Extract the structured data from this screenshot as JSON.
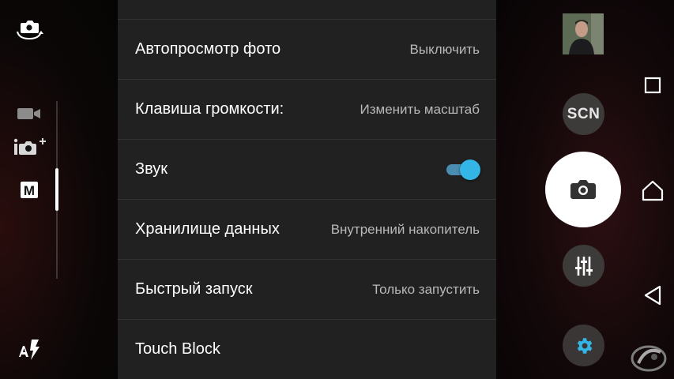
{
  "settings": {
    "rows": [
      {
        "label": "Автопросмотр фото",
        "value": "Выключить"
      },
      {
        "label": "Клавиша громкости:",
        "value": "Изменить масштаб"
      },
      {
        "label": "Звук",
        "toggle": true
      },
      {
        "label": "Хранилище данных",
        "value": "Внутренний накопитель"
      },
      {
        "label": "Быстрый запуск",
        "value": "Только запустить"
      },
      {
        "label": "Touch Block"
      }
    ]
  },
  "mode_selector": {
    "modes": [
      "video-camera-icon",
      "superior-auto-icon",
      "manual-mode-icon"
    ],
    "selected": "manual-mode-icon",
    "manual_label": "M"
  },
  "controls": {
    "scene_label": "SCN",
    "icons": [
      "switch-camera-icon",
      "flash-auto-icon",
      "shutter-camera-icon",
      "manual-adjust-icon",
      "settings-gear-icon"
    ]
  },
  "navigation": {
    "icons": [
      "recent-apps-icon",
      "home-icon",
      "back-icon"
    ]
  },
  "colors": {
    "panel": "#212121",
    "accent": "#33b5e5",
    "label": "#ffffff",
    "value": "#b9b9b9"
  }
}
